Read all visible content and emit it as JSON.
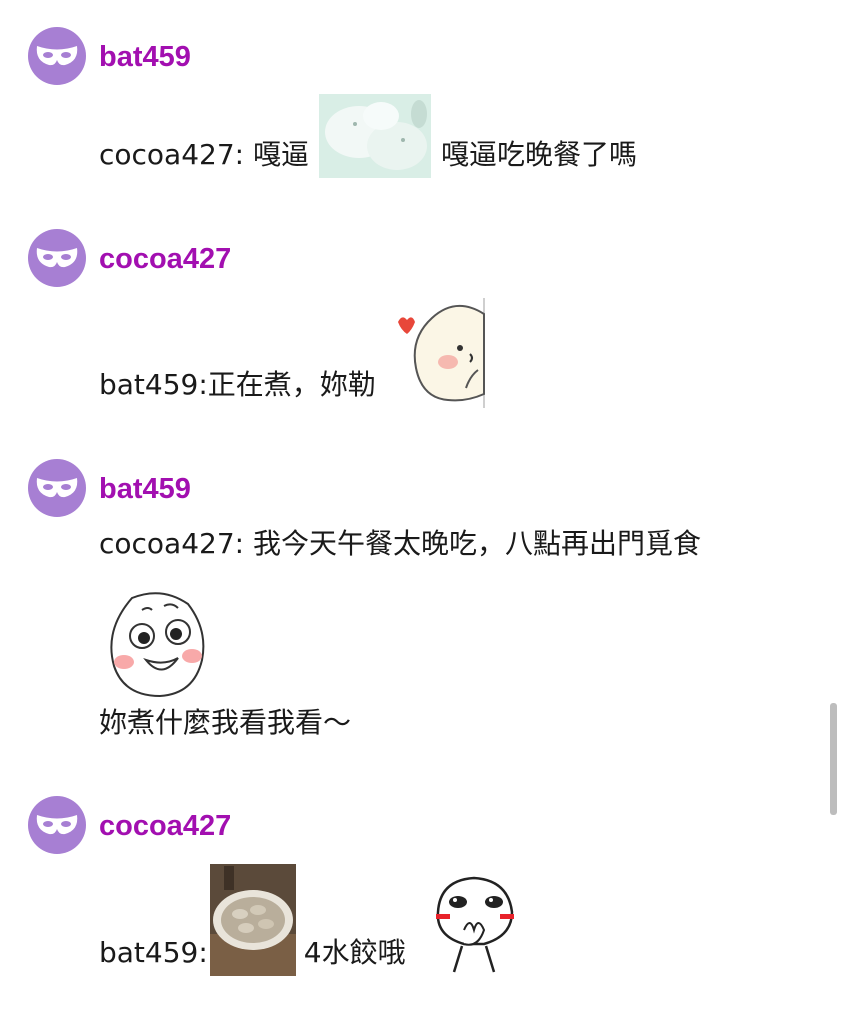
{
  "posts": [
    {
      "username": "bat459",
      "segments": [
        "cocoa427: 嘎逼",
        "嘎逼吃晚餐了嗎"
      ]
    },
    {
      "username": "cocoa427",
      "segments": [
        "bat459:正在煮，妳勒"
      ]
    },
    {
      "username": "bat459",
      "segments": [
        "cocoa427: 我今天午餐太晚吃，八點再出門覓食",
        "妳煮什麼我看我看～"
      ]
    },
    {
      "username": "cocoa427",
      "segments": [
        "bat459:",
        "4水餃哦"
      ]
    }
  ],
  "colors": {
    "accent": "#a20fb0",
    "avatar": "#a77fd3"
  },
  "icons": [
    "mask-icon"
  ]
}
